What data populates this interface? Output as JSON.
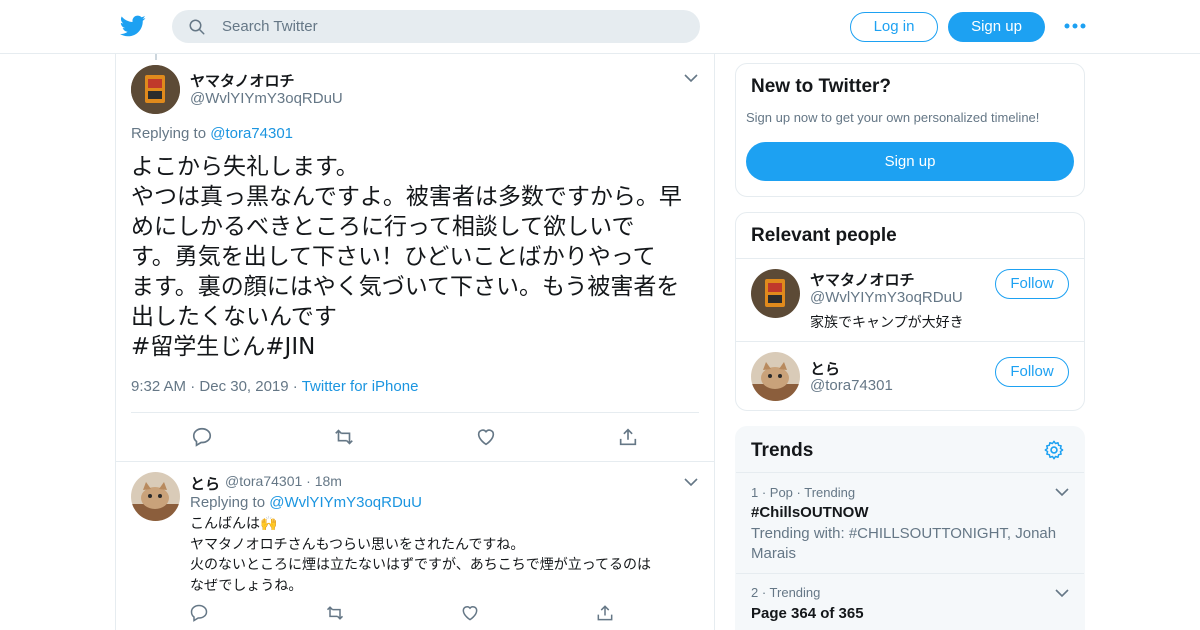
{
  "colors": {
    "accent": "#1da1f2",
    "link": "#1b95e0",
    "secondary_text": "#657786",
    "border": "#e6ecf0",
    "trends_bg": "#f5f8fa"
  },
  "header": {
    "logo_icon": "twitter-bird-icon",
    "search_placeholder": "Search Twitter",
    "login_label": "Log in",
    "signup_label": "Sign up",
    "more_icon": "more-dots-icon"
  },
  "tweet": {
    "author_name": "ヤマタノオロチ",
    "author_handle": "@WvlYIYmY3oqRDuU",
    "replying_prefix": "Replying to",
    "replying_to": "@tora74301",
    "text_lines": [
      "よこから失礼します。",
      "やつは真っ黒なんですよ。被害者は多数ですから。早",
      "めにしかるべきところに行って相談して欲しいで",
      "す。勇気を出して下さい！ひどいことばかりやって",
      "ます。裏の顔にはやく気づいて下さい。もう被害者を",
      "出したくないんです",
      "#留学生じん#JIN"
    ],
    "time": "9:32 AM",
    "date": "Dec 30, 2019",
    "sep": "·",
    "source": "Twitter for iPhone"
  },
  "reply": {
    "author_name": "とら",
    "author_handle": "@tora74301",
    "sep": "·",
    "age": "18m",
    "replying_prefix": "Replying to",
    "replying_to": "@WvlYIYmY3oqRDuU",
    "text_lines": [
      "こんばんは🙌",
      "ヤマタノオロチさんもつらい思いをされたんですね。",
      "火のないところに煙は立たないはずですが、あちこちで煙が立ってるのは",
      "なぜでしょうね。"
    ]
  },
  "new_to_twitter": {
    "title": "New to Twitter?",
    "subtitle": "Sign up now to get your own personalized timeline!",
    "button": "Sign up"
  },
  "relevant_people": {
    "title": "Relevant people",
    "people": [
      {
        "name": "ヤマタノオロチ",
        "handle": "@WvlYIYmY3oqRDuU",
        "bio": "家族でキャンプが大好き",
        "button": "Follow"
      },
      {
        "name": "とら",
        "handle": "@tora74301",
        "bio": "",
        "button": "Follow"
      }
    ]
  },
  "trends": {
    "title": "Trends",
    "settings_icon": "gear-icon",
    "items": [
      {
        "meta": "1 · Pop · Trending",
        "name": "#ChillsOUTNOW",
        "with": "Trending with: #CHILLSOUTTONIGHT, Jonah Marais"
      },
      {
        "meta": "2 · Trending",
        "name": "Page 364 of 365",
        "with": ""
      }
    ]
  }
}
